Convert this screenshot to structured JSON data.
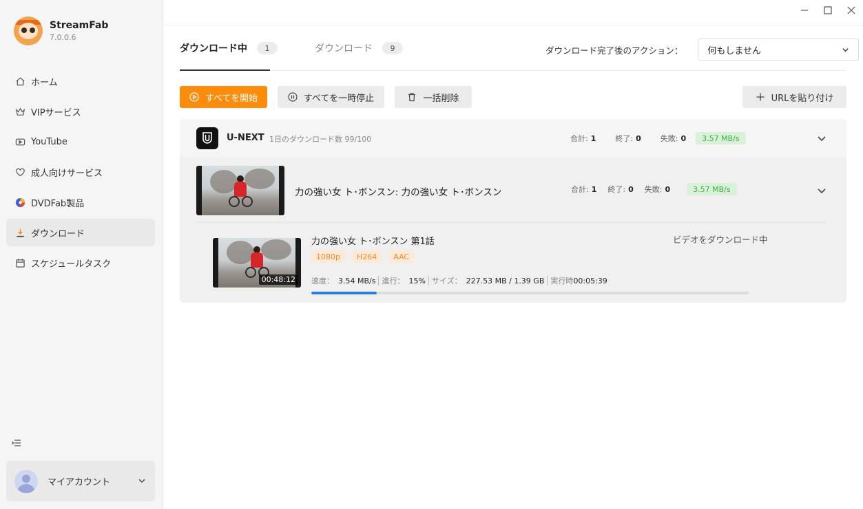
{
  "app": {
    "name": "StreamFab",
    "version": "7.0.0.6"
  },
  "sidebar": {
    "items": [
      {
        "label": "ホーム",
        "icon": "home-icon"
      },
      {
        "label": "VIPサービス",
        "icon": "crown-icon"
      },
      {
        "label": "YouTube",
        "icon": "youtube-icon"
      },
      {
        "label": "成人向けサービス",
        "icon": "heart-icon"
      },
      {
        "label": "DVDFab製品",
        "icon": "dvdfab-icon"
      },
      {
        "label": "ダウンロード",
        "icon": "download-icon",
        "active": true
      },
      {
        "label": "スケジュールタスク",
        "icon": "calendar-icon"
      }
    ],
    "account_label": "マイアカウント"
  },
  "tabs": [
    {
      "label": "ダウンロード中",
      "count": "1",
      "active": true
    },
    {
      "label": "ダウンロード",
      "count": "9",
      "active": false
    }
  ],
  "after_action": {
    "label": "ダウンロード完了後のアクション：",
    "selected": "何もしません"
  },
  "toolbar": {
    "start_all": "すべてを開始",
    "pause_all": "すべてを一時停止",
    "delete_all": "一括削除",
    "paste_url": "URLを貼り付け"
  },
  "group": {
    "service": "U-NEXT",
    "daily_count": "1日のダウンロード数 99/100",
    "stats": {
      "total_label": "合計:",
      "total": "1",
      "done_label": "終了:",
      "done": "0",
      "failed_label": "失敗:",
      "failed": "0",
      "speed": "3.57 MB/s"
    }
  },
  "series": {
    "title": "力の強い女 ト･ボンスン: 力の強い女 ト･ボンスン",
    "stats": {
      "total_label": "合計:",
      "total": "1",
      "done_label": "終了:",
      "done": "0",
      "failed_label": "失敗:",
      "failed": "0",
      "speed": "3.57 MB/s"
    }
  },
  "episode": {
    "title": "力の強い女 ト･ボンスン 第1話",
    "duration": "00:48:12",
    "tags": [
      "1080p",
      "H264",
      "AAC"
    ],
    "status": "ビデオをダウンロード中",
    "speed_label": "速度：",
    "speed": "3.54 MB/s",
    "progress_label": "進行：",
    "progress_text": "15%",
    "size_label": "サイズ：",
    "size": "227.53 MB / 1.39 GB",
    "elapsed_label": "実行時",
    "elapsed": "00:05:39",
    "progress": 0.15
  },
  "colors": {
    "accent_orange": "#fb8c0c",
    "progress_blue": "#2b7fd8",
    "speed_green": "#3fae3f",
    "tag_orange": "#f08a2c"
  }
}
